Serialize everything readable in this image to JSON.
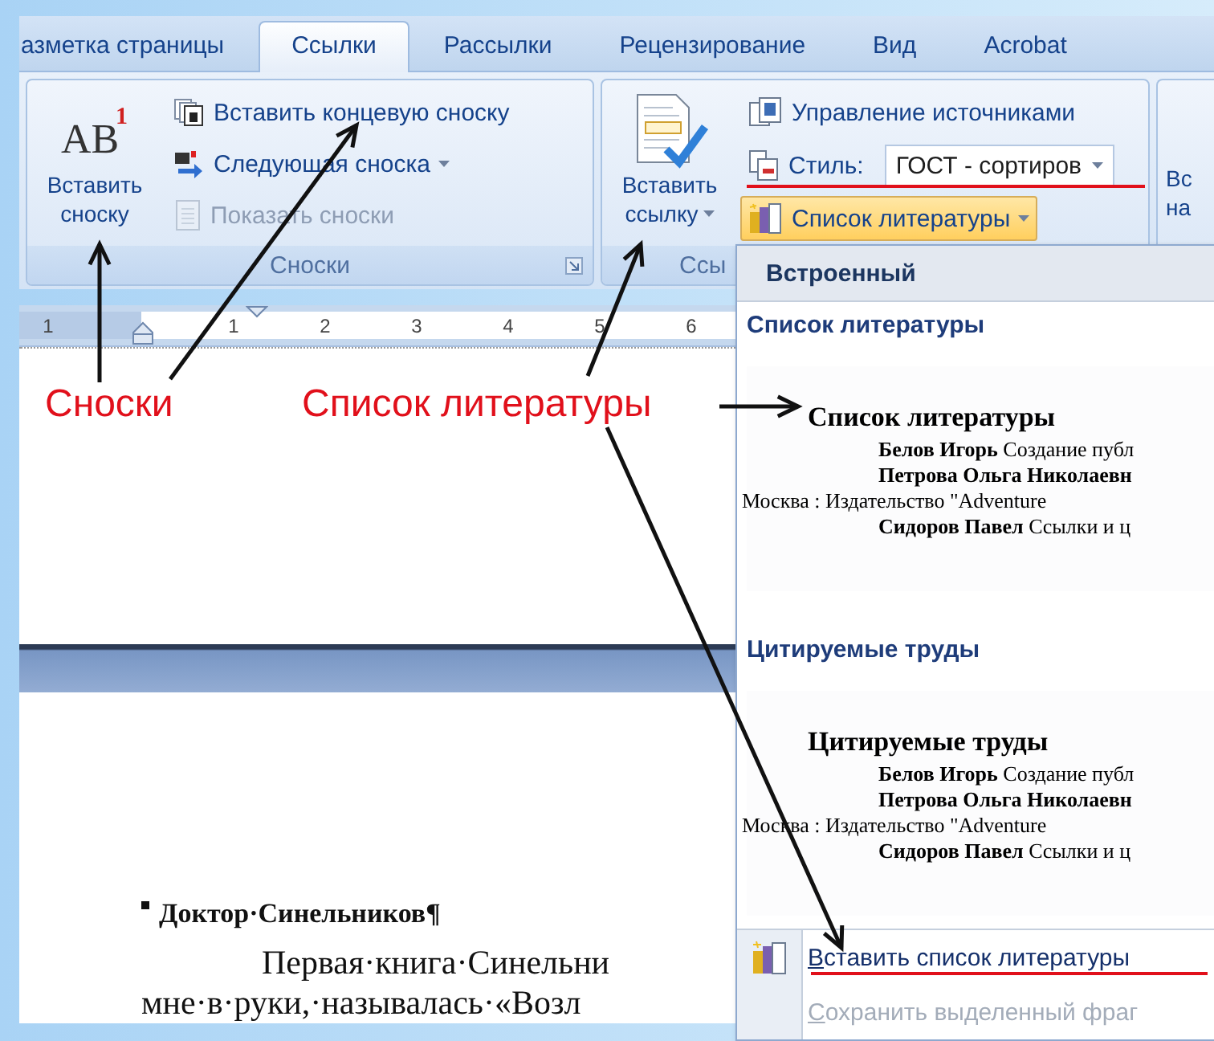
{
  "tabs": [
    {
      "label": "азметка страницы",
      "selected": false
    },
    {
      "label": "Ссылки",
      "selected": true
    },
    {
      "label": "Рассылки",
      "selected": false
    },
    {
      "label": "Рецензирование",
      "selected": false
    },
    {
      "label": "Вид",
      "selected": false
    },
    {
      "label": "Acrobat",
      "selected": false
    }
  ],
  "ribbon": {
    "groups": [
      {
        "label": "Сноски",
        "big_button": {
          "lines": [
            "Вставить",
            "сноску"
          ],
          "dropdown": false,
          "icon_text": "AB",
          "icon_mark": "1"
        },
        "small_buttons": [
          {
            "kind": "button",
            "label": "Вставить концевую сноску",
            "disabled": false,
            "active": false
          },
          {
            "kind": "dropdown",
            "label": "Следующая сноска",
            "disabled": false,
            "active": false
          },
          {
            "kind": "button",
            "label": "Показать сноски",
            "disabled": true,
            "active": false
          }
        ]
      },
      {
        "label": "Ссы",
        "big_button": {
          "lines": [
            "Вставить",
            "ссылку"
          ],
          "dropdown": true
        },
        "small_buttons": [
          {
            "kind": "button",
            "label": "Управление источниками",
            "disabled": false,
            "active": false
          },
          {
            "kind": "combo",
            "label": "Стиль:",
            "value": "ГОСТ - сортиров",
            "disabled": false,
            "active": false
          },
          {
            "kind": "dropdown",
            "label": "Список литературы",
            "disabled": false,
            "active": true
          }
        ]
      },
      {
        "big_button": {
          "lines": [
            "Вс",
            "на"
          ],
          "dropdown": false
        }
      }
    ]
  },
  "ruler": {
    "numbers": [
      "1",
      "1",
      "2",
      "3",
      "4",
      "5",
      "6"
    ]
  },
  "document": {
    "heading": "Доктор·Синельников¶",
    "paragraph_lines": [
      "Первая·книга·Синельни",
      "мне·в·руки,·называлась·«Возл"
    ]
  },
  "annotations": [
    {
      "text": "Сноски"
    },
    {
      "text": "Список литературы"
    }
  ],
  "bibliography_menu": {
    "header": "Встроенный",
    "sections": [
      {
        "title": "Список литературы",
        "preview": {
          "heading": "Список литературы",
          "entries": [
            {
              "kind": "entry",
              "text": "**Белов Игорь** Создание публ"
            },
            {
              "kind": "entry",
              "text": "**Петрова Ольга Николаевн**"
            },
            {
              "kind": "continuation",
              "text": "Москва : Издательство \"Adventure"
            },
            {
              "kind": "entry",
              "text": "**Сидоров Павел** Ссылки и ц"
            }
          ]
        }
      },
      {
        "title": "Цитируемые труды",
        "preview": {
          "heading": "Цитируемые труды",
          "entries": [
            {
              "kind": "entry",
              "text": "**Белов Игорь** Создание публ"
            },
            {
              "kind": "entry",
              "text": "**Петрова Ольга Николаевн**"
            },
            {
              "kind": "continuation",
              "text": "Москва : Издательство \"Adventure"
            },
            {
              "kind": "entry",
              "text": "**Сидоров Павел** Ссылки и ц"
            }
          ]
        }
      }
    ],
    "actions": [
      {
        "label": "Вставить список литературы",
        "disabled": false
      },
      {
        "label": "Сохранить выделенный фраг",
        "disabled": true
      }
    ]
  }
}
